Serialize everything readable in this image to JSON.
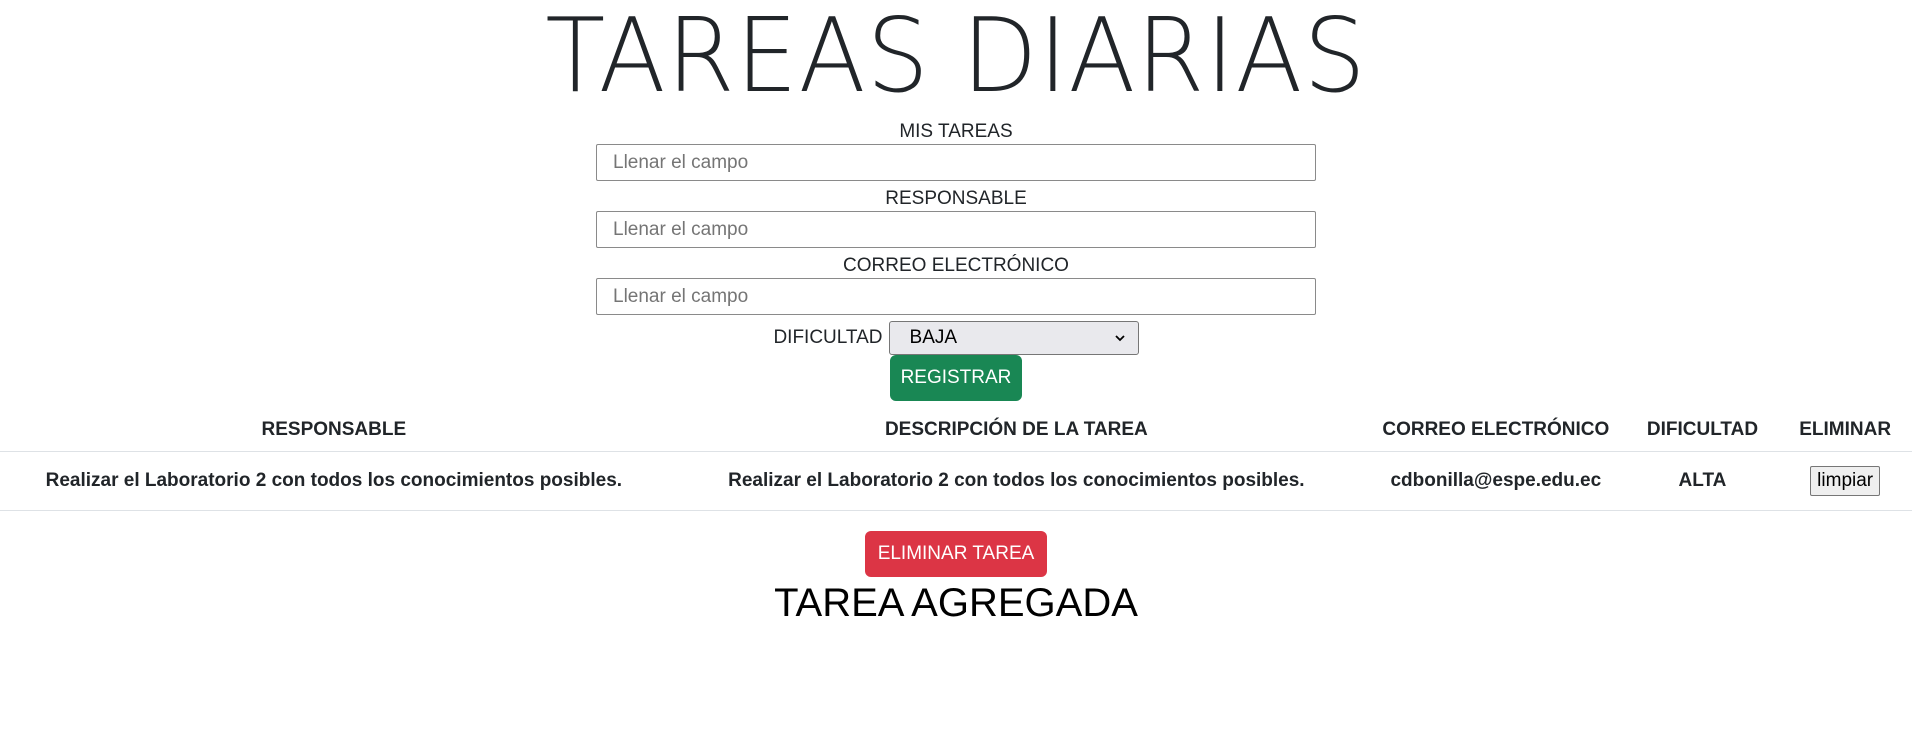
{
  "page": {
    "title": "TAREAS DIARIAS",
    "footer_message": "TAREA AGREGADA"
  },
  "form": {
    "tareas_label": "MIS TAREAS",
    "tareas_placeholder": "Llenar el campo",
    "tareas_value": "",
    "responsable_label": "RESPONSABLE",
    "responsable_placeholder": "Llenar el campo",
    "responsable_value": "",
    "correo_label": "CORREO ELECTRÓNICO",
    "correo_placeholder": "Llenar el campo",
    "correo_value": "",
    "dificultad_label": "DIFICULTAD",
    "dificultad_selected": "BAJA",
    "register_label": "REGISTRAR"
  },
  "table": {
    "headers": {
      "responsable": "RESPONSABLE",
      "descripcion": "DESCRIPCIÓN DE LA TAREA",
      "correo": "CORREO ELECTRÓNICO",
      "dificultad": "DIFICULTAD",
      "eliminar": "ELIMINAR"
    },
    "rows": [
      {
        "responsable": "Realizar el Laboratorio 2 con todos los conocimientos posibles.",
        "descripcion": "Realizar el Laboratorio 2 con todos los conocimientos posibles.",
        "correo": "cdbonilla@espe.edu.ec",
        "dificultad": "ALTA",
        "action_label": "limpiar"
      }
    ]
  },
  "actions": {
    "delete_label": "ELIMINAR TAREA"
  },
  "colors": {
    "success": "#198754",
    "danger": "#dc3545",
    "text": "#212529"
  },
  "icons": {
    "select_arrow": "chevron-down-icon"
  }
}
